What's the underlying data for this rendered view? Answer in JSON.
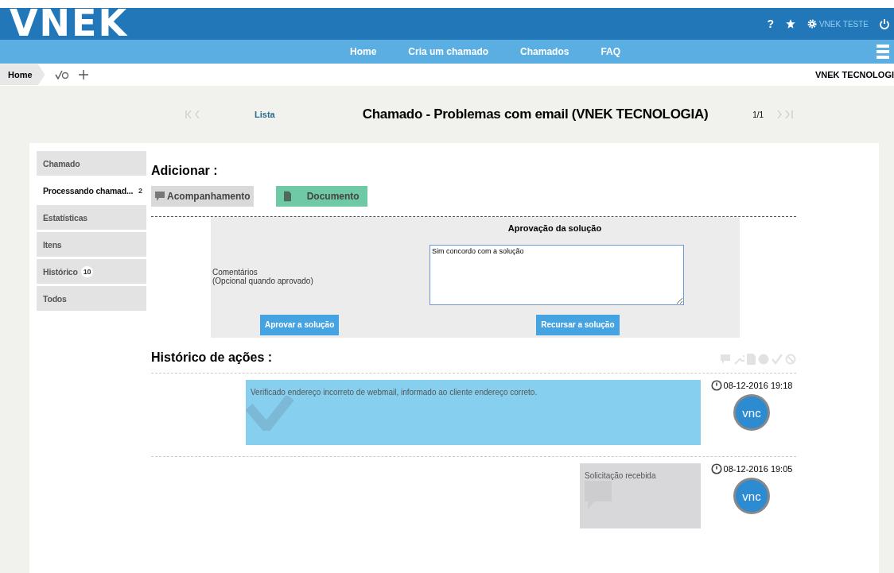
{
  "header": {
    "logo": "VNEK",
    "help": "?",
    "user": "VNEK TESTE",
    "nav": [
      "Home",
      "Cria um chamado",
      "Chamados",
      "FAQ"
    ]
  },
  "breadcrumb": {
    "home": "Home",
    "company": "VNEK TECNOLOGI"
  },
  "ticket_nav": {
    "list": "Lista",
    "title": "Chamado - Problemas com email (VNEK TECNOLOGIA)",
    "counter": "1/1"
  },
  "sidebar": {
    "items": [
      {
        "label": "Chamado",
        "selected": false
      },
      {
        "label": "Processando chamad...",
        "selected": true,
        "badge": "2"
      },
      {
        "label": "Estatísticas",
        "selected": false
      },
      {
        "label": "Itens",
        "selected": false
      },
      {
        "label": "Histórico",
        "selected": false,
        "badge": "10"
      },
      {
        "label": "Todos",
        "selected": false
      }
    ]
  },
  "add": {
    "heading": "Adicionar :",
    "buttons": [
      {
        "label": "Acompanhamento",
        "kind": "followup"
      },
      {
        "label": "Documento",
        "kind": "document"
      }
    ]
  },
  "approval": {
    "title": "Aprovação da solução",
    "comment_label": "Comentários",
    "comment_hint": "(Opcional quando aprovado)",
    "comment": "Sim concordo com a solução",
    "approve": "Aprovar a solução",
    "refuse": "Recursar a solução"
  },
  "history": {
    "heading": "Histórico de ações :",
    "entries": [
      {
        "kind": "solution",
        "text": "Verificado endereço incorreto de webmail, informado ao cliente endereço correto.",
        "time": "08-12-2016 19:18",
        "avatar": "vnc"
      },
      {
        "kind": "followup",
        "text": "Solicitação recebida",
        "time": "08-12-2016 19:05",
        "avatar": "vnc"
      }
    ]
  }
}
